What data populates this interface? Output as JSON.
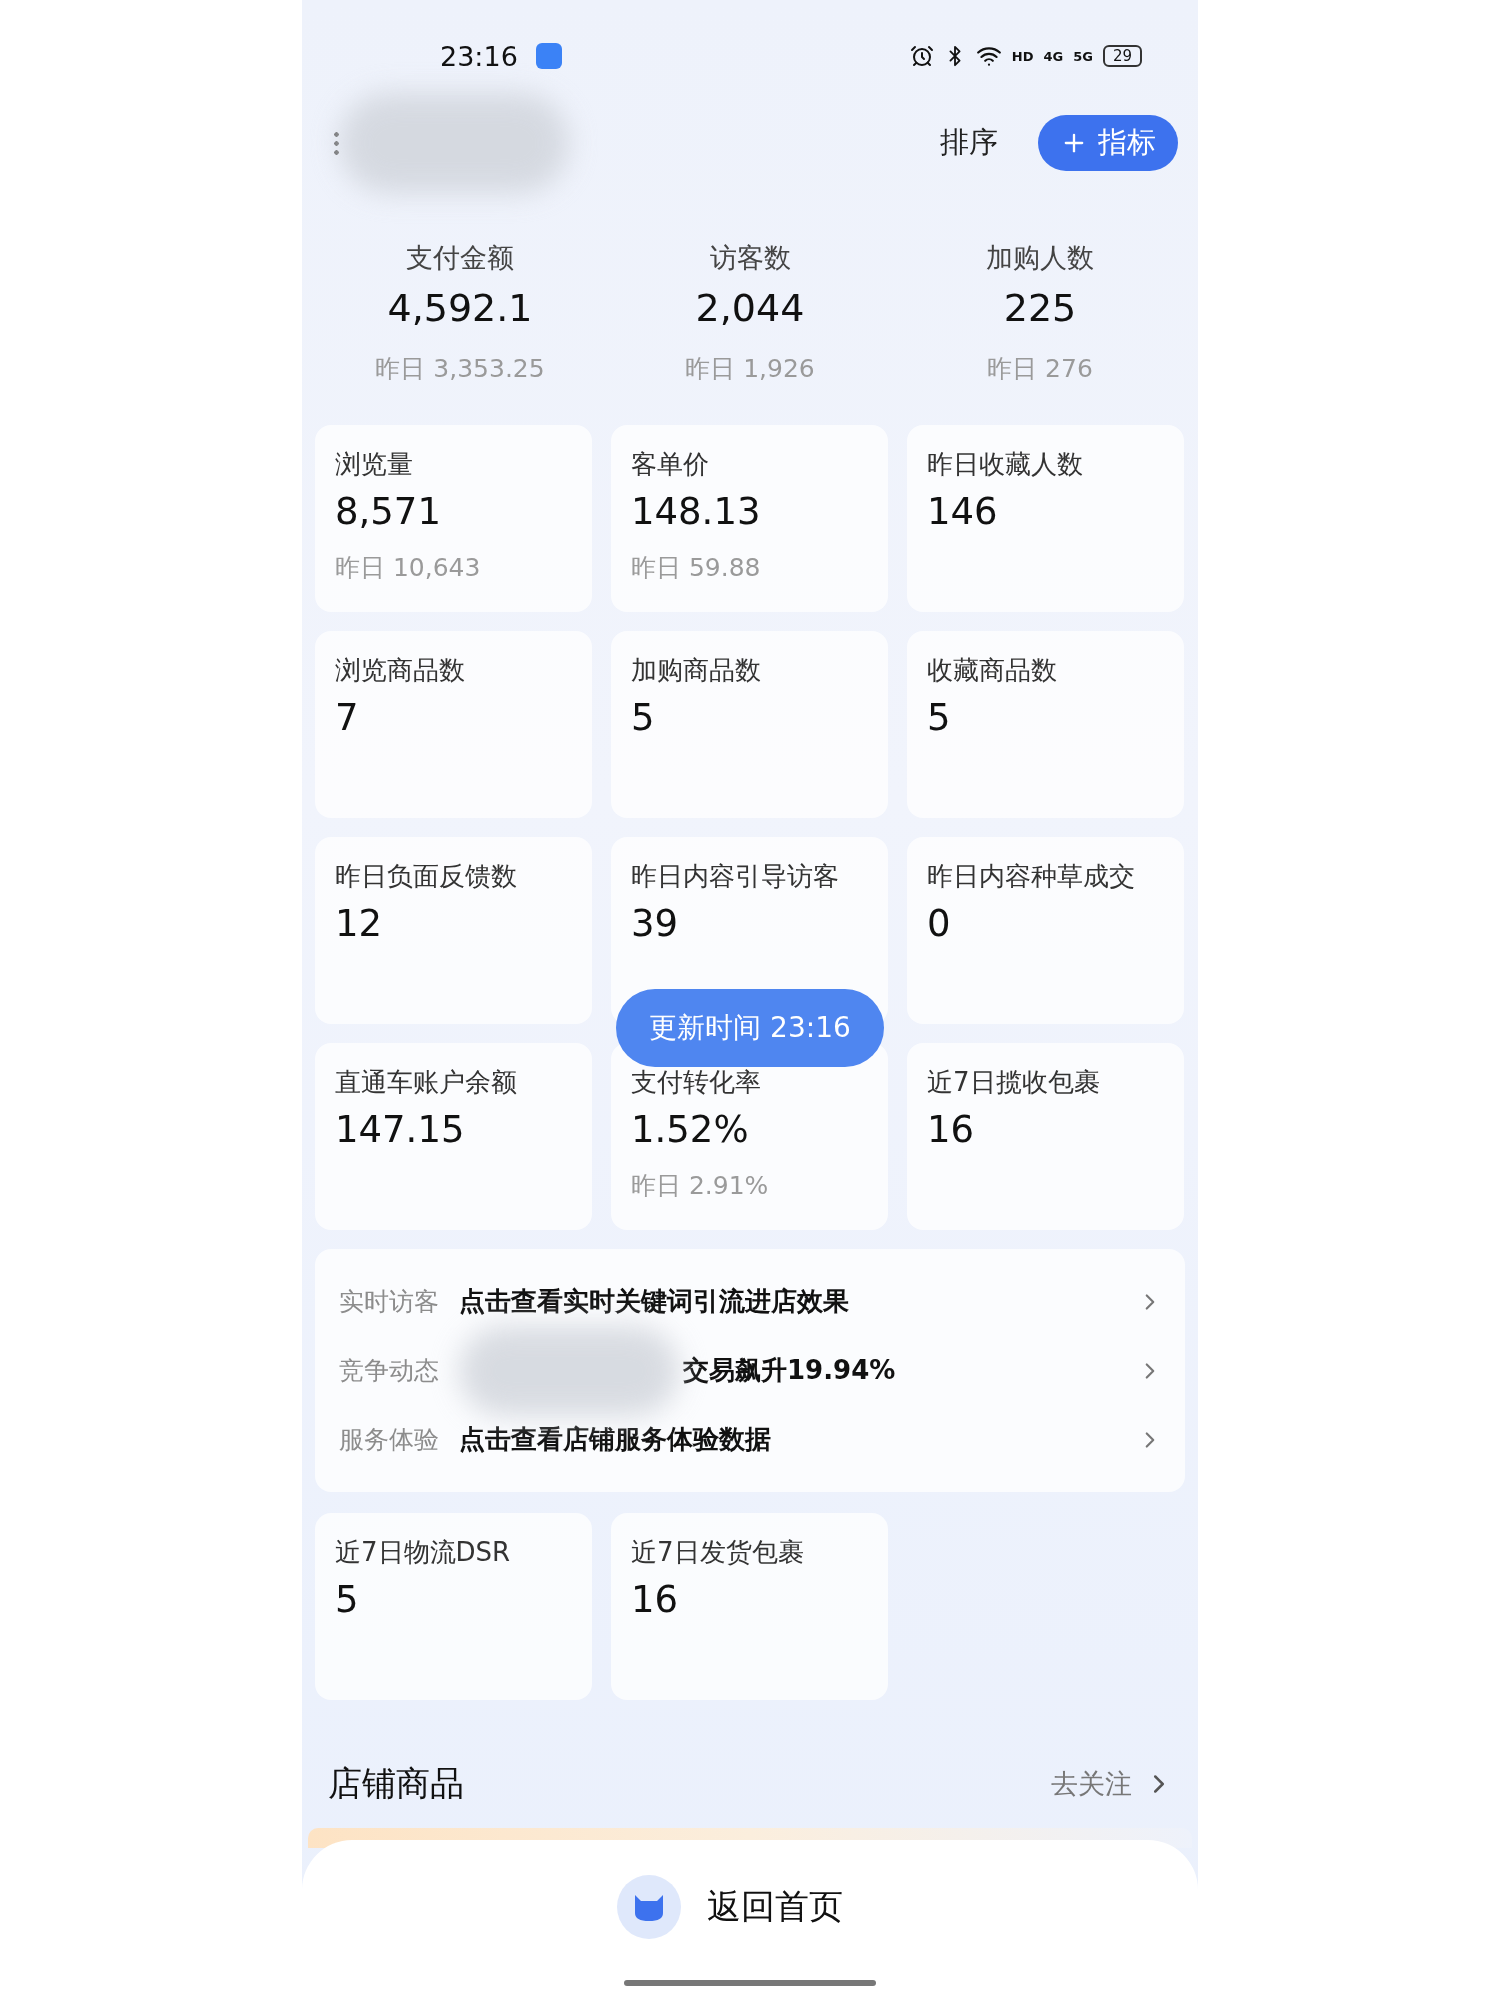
{
  "status_bar": {
    "time": "23:16",
    "badges": [
      "HD",
      "4G",
      "5G"
    ],
    "battery": "29"
  },
  "header": {
    "sort": "排序",
    "add_button": "指标"
  },
  "summary": [
    {
      "label": "支付金额",
      "value": "4,592.1",
      "yesterday": "昨日 3,353.25"
    },
    {
      "label": "访客数",
      "value": "2,044",
      "yesterday": "昨日 1,926"
    },
    {
      "label": "加购人数",
      "value": "225",
      "yesterday": "昨日 276"
    }
  ],
  "cards": [
    {
      "label": "浏览量",
      "value": "8,571",
      "yesterday": "昨日 10,643"
    },
    {
      "label": "客单价",
      "value": "148.13",
      "yesterday": "昨日 59.88"
    },
    {
      "label": "昨日收藏人数",
      "value": "146"
    },
    {
      "label": "浏览商品数",
      "value": "7"
    },
    {
      "label": "加购商品数",
      "value": "5"
    },
    {
      "label": "收藏商品数",
      "value": "5"
    },
    {
      "label": "昨日负面反馈数",
      "value": "12"
    },
    {
      "label": "昨日内容引导访客",
      "value": "39"
    },
    {
      "label": "昨日内容种草成交",
      "value": "0"
    },
    {
      "label": "直通车账户余额",
      "value": "147.15"
    },
    {
      "label": "支付转化率",
      "value": "1.52%",
      "yesterday": "昨日 2.91%"
    },
    {
      "label": "近7日揽收包裹",
      "value": "16"
    }
  ],
  "update_badge": "更新时间 23:16",
  "insights": [
    {
      "label": "实时访客",
      "text": "点击查看实时关键词引流进店效果",
      "blurred": false
    },
    {
      "label": "竞争动态",
      "text": "交易飙升19.94%",
      "blurred": true
    },
    {
      "label": "服务体验",
      "text": "点击查看店铺服务体验数据",
      "blurred": false
    }
  ],
  "cards_2": [
    {
      "label": "近7日物流DSR",
      "value": "5"
    },
    {
      "label": "近7日发货包裹",
      "value": "16"
    }
  ],
  "section": {
    "title": "店铺商品",
    "link": "去关注"
  },
  "bottom": {
    "home": "返回首页"
  }
}
